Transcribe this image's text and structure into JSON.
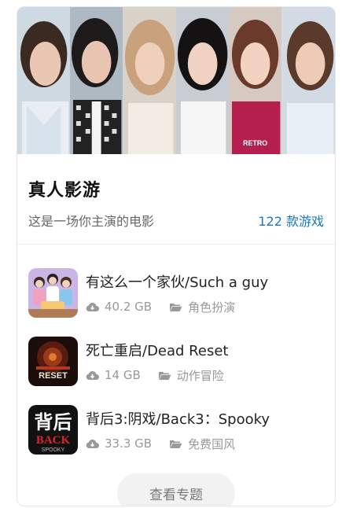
{
  "topic": {
    "title": "真人影游",
    "subtitle": "这是一场你主演的电影",
    "count": "122 款游戏"
  },
  "games": [
    {
      "name": "有这么一个家伙/Such a guy",
      "size": "40.2 GB",
      "genre": "角色扮演"
    },
    {
      "name": "死亡重启/Dead Reset",
      "size": "14 GB",
      "genre": "动作冒险"
    },
    {
      "name": "背后3:阴戏/Back3：Spooky",
      "size": "33.3 GB",
      "genre": "免费国风"
    }
  ],
  "thumb_text": {
    "dead_reset": "RESET",
    "back_cn": "背后",
    "back_en": "BACK",
    "back_sub": "SPOOKY"
  },
  "banner_text": "RETRO",
  "view_button": "查看专题",
  "icons": {
    "download": "cloud-download-icon",
    "category": "folder-icon"
  },
  "colors": {
    "accent": "#1677c7",
    "muted": "#999999"
  }
}
